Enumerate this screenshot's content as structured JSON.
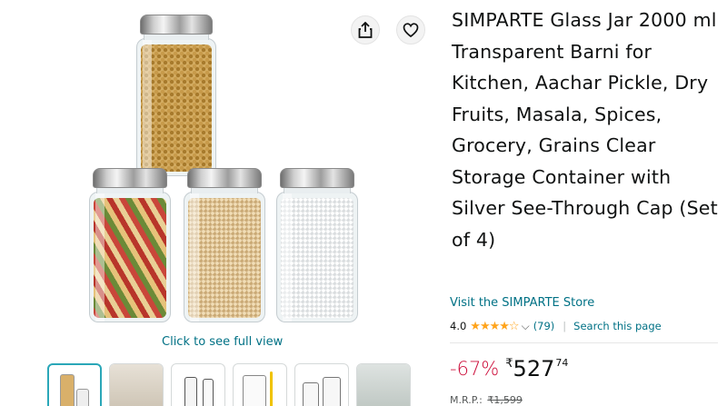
{
  "product": {
    "title": "SIMPARTE Glass Jar 2000 ml Transparent Barni for Kitchen, Aachar Pickle, Dry Fruits, Masala, Spices, Grocery, Grains Clear Storage Container with Silver See-Through Cap (Set of 4)",
    "store_link": "Visit the SIMPARTE Store",
    "rating": "4.0",
    "stars_glyphs": "★★★★☆",
    "rating_count": "(79)",
    "search_page": "Search this page",
    "discount": "-67%",
    "currency": "₹",
    "price_whole": "527",
    "price_fraction": "74",
    "mrp_label": "M.R.P.:",
    "mrp_value": "₹1,599"
  },
  "gallery": {
    "full_view_label": "Click to see full view",
    "share_icon": "share-icon",
    "wishlist_icon": "heart-icon",
    "thumbnail_count": 6,
    "selected_thumbnail": 1
  },
  "colors": {
    "link": "#007185",
    "discount": "#cc0c39",
    "star": "#ffa41c",
    "thumb_selected": "#2aa7b8"
  }
}
